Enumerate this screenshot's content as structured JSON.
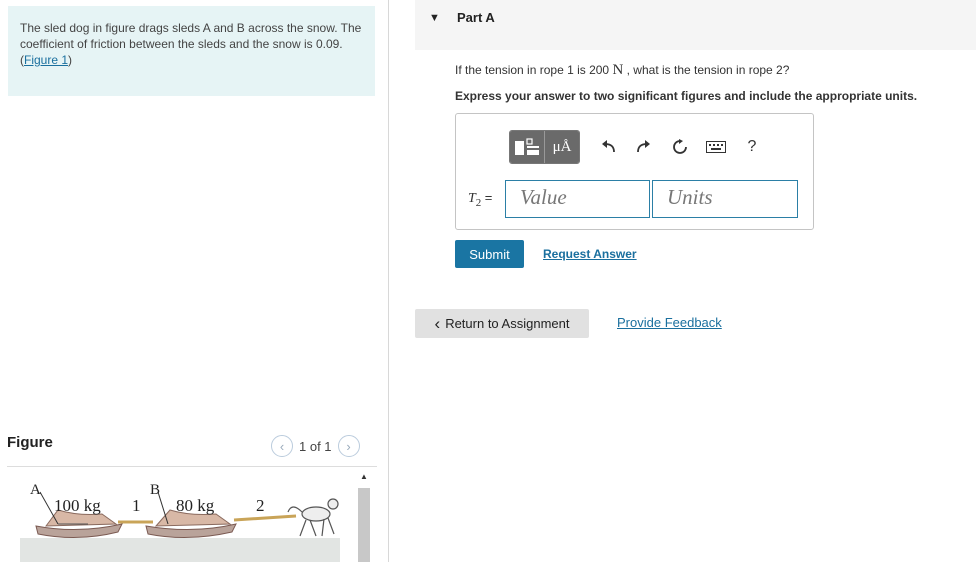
{
  "problem": {
    "text": "The sled dog in figure drags sleds A and B across the snow. The coefficient of friction between the sleds and the snow is 0.09.",
    "figure_link": "Figure 1"
  },
  "figure": {
    "heading": "Figure",
    "pager": "1 of 1",
    "label_a": "A",
    "label_b": "B",
    "mass_a": "100 kg",
    "mass_b": "80 kg",
    "rope1": "1",
    "rope2": "2"
  },
  "part": {
    "title": "Part A",
    "question_before": "If the tension in rope 1 is 200",
    "question_unit": "N",
    "question_after": ", what is the tension in rope 2?",
    "instruction": "Express your answer to two significant figures and include the appropriate units."
  },
  "answer": {
    "variable": "T",
    "subscript": "2",
    "equals": "=",
    "value_placeholder": "Value",
    "units_placeholder": "Units"
  },
  "toolbar": {
    "units_symbol": "μÅ",
    "help_label": "?"
  },
  "actions": {
    "submit": "Submit",
    "request_answer": "Request Answer",
    "return": "Return to Assignment",
    "feedback": "Provide Feedback"
  }
}
